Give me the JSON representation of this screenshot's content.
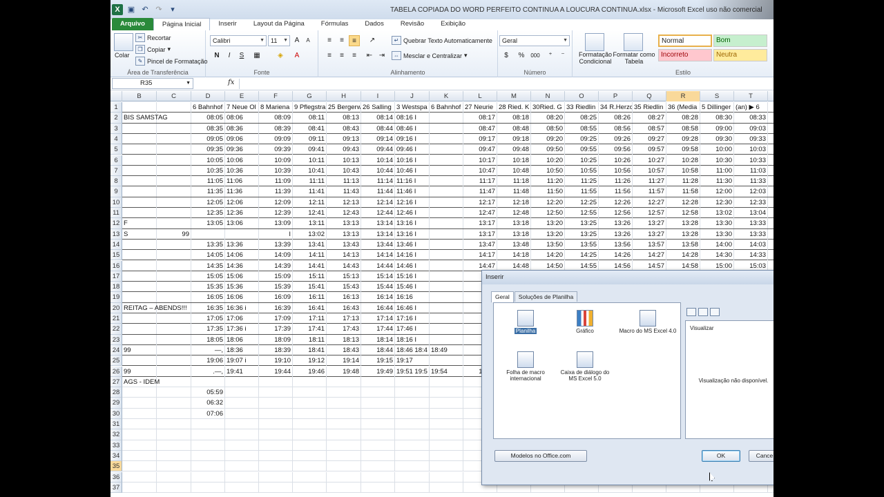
{
  "window": {
    "title": "TABELA COPIADA DO WORD PERFEITO CONTINUA A LOUCURA CONTINUA.xlsx - Microsoft Excel uso não comercial"
  },
  "tabs": [
    "Arquivo",
    "Página Inicial",
    "Inserir",
    "Layout da Página",
    "Fórmulas",
    "Dados",
    "Revisão",
    "Exibição"
  ],
  "ribbon": {
    "clipboard": {
      "paste": "Colar",
      "cut": "Recortar",
      "copy": "Copiar",
      "format_painter": "Pincel de Formatação",
      "label": "Área de Transferência"
    },
    "font": {
      "name": "Calibri",
      "size": "11",
      "bold": "N",
      "italic": "I",
      "underline": "S",
      "label": "Fonte"
    },
    "alignment": {
      "wrap": "Quebrar Texto Automaticamente",
      "merge": "Mesclar e Centralizar",
      "label": "Alinhamento"
    },
    "number": {
      "format": "Geral",
      "percent": "%",
      "thousands": "000",
      "label": "Número"
    },
    "styles": {
      "cond_format": "Formatação Condicional",
      "as_table": "Formatar como Tabela",
      "normal": "Normal",
      "bom": "Bom",
      "incorreto": "Incorreto",
      "neutra": "Neutra",
      "label": "Estilo"
    }
  },
  "formula_bar": {
    "name_box": "R35",
    "fx": "fx",
    "value": ""
  },
  "columns": [
    "B",
    "C",
    "D",
    "E",
    "F",
    "G",
    "H",
    "I",
    "J",
    "K",
    "L",
    "M",
    "N",
    "O",
    "P",
    "Q",
    "R",
    "S",
    "T"
  ],
  "selected_column": "R",
  "selected_row": "35",
  "rows": [
    {
      "n": "1",
      "c": {
        "D": "6 Bahnhof",
        "E": "7 Neue Ol",
        "F": "8 Mariena",
        "G": "9 Pflegstra",
        "H": "25 Bergerw",
        "I": "26 Salling",
        "J": "3 Westspa",
        "K": "6 Bahnhof",
        "L": "27 Neurie",
        "M": "28 Ried. K",
        "N": "30Ried. G",
        "O": "33 Riedlin",
        "P": "34 R.Herzo",
        "Q": "35 Riedlin",
        "R": "36 (Media",
        "S": "5 Dillinger",
        "T": "(an) ▶  6"
      }
    },
    {
      "n": "2",
      "c": {
        "B": "BIS SAMSTAG",
        "D": "08:05",
        "E": "08:06",
        "F": "08:09",
        "G": "08:11",
        "H": "08:13",
        "I": "08:14",
        "J": "08:16 I",
        "L": "08:17",
        "M": "08:18",
        "N": "08:20",
        "O": "08:25",
        "P": "08:26",
        "Q": "08:27",
        "R": "08:28",
        "S": "08:30",
        "T": "08:33"
      }
    },
    {
      "n": "3",
      "c": {
        "D": "08:35",
        "E": "08:36",
        "F": "08:39",
        "G": "08:41",
        "H": "08:43",
        "I": "08:44",
        "J": "08:46 I",
        "L": "08:47",
        "M": "08:48",
        "N": "08:50",
        "O": "08:55",
        "P": "08:56",
        "Q": "08:57",
        "R": "08:58",
        "S": "09:00",
        "T": "09:03"
      }
    },
    {
      "n": "4",
      "c": {
        "D": "09:05",
        "E": "09:06",
        "F": "09:09",
        "G": "09:11",
        "H": "09:13",
        "I": "09:14",
        "J": "09:16 I",
        "L": "09:17",
        "M": "09:18",
        "N": "09:20",
        "O": "09:25",
        "P": "09:26",
        "Q": "09:27",
        "R": "09:28",
        "S": "09:30",
        "T": "09:33"
      }
    },
    {
      "n": "5",
      "c": {
        "D": "09:35",
        "E": "09:36",
        "F": "09:39",
        "G": "09:41",
        "H": "09:43",
        "I": "09:44",
        "J": "09:46 I",
        "L": "09:47",
        "M": "09:48",
        "N": "09:50",
        "O": "09:55",
        "P": "09:56",
        "Q": "09:57",
        "R": "09:58",
        "S": "10:00",
        "T": "10:03"
      }
    },
    {
      "n": "6",
      "c": {
        "D": "10:05",
        "E": "10:06",
        "F": "10:09",
        "G": "10:11",
        "H": "10:13",
        "I": "10:14",
        "J": "10:16 I",
        "L": "10:17",
        "M": "10:18",
        "N": "10:20",
        "O": "10:25",
        "P": "10:26",
        "Q": "10:27",
        "R": "10:28",
        "S": "10:30",
        "T": "10:33"
      }
    },
    {
      "n": "7",
      "c": {
        "D": "10:35",
        "E": "10:36",
        "F": "10:39",
        "G": "10:41",
        "H": "10:43",
        "I": "10:44",
        "J": "10:46 I",
        "L": "10:47",
        "M": "10:48",
        "N": "10:50",
        "O": "10:55",
        "P": "10:56",
        "Q": "10:57",
        "R": "10:58",
        "S": "11:00",
        "T": "11:03"
      }
    },
    {
      "n": "8",
      "c": {
        "D": "11:05",
        "E": "11:06",
        "F": "11:09",
        "G": "11:11",
        "H": "11:13",
        "I": "11:14",
        "J": "11:16 I",
        "L": "11:17",
        "M": "11:18",
        "N": "11:20",
        "O": "11:25",
        "P": "11:26",
        "Q": "11:27",
        "R": "11:28",
        "S": "11:30",
        "T": "11:33"
      }
    },
    {
      "n": "9",
      "c": {
        "D": "11:35",
        "E": "11:36",
        "F": "11:39",
        "G": "11:41",
        "H": "11:43",
        "I": "11:44",
        "J": "11:46 I",
        "L": "11:47",
        "M": "11:48",
        "N": "11:50",
        "O": "11:55",
        "P": "11:56",
        "Q": "11:57",
        "R": "11:58",
        "S": "12:00",
        "T": "12:03"
      }
    },
    {
      "n": "10",
      "c": {
        "D": "12:05",
        "E": "12:06",
        "F": "12:09",
        "G": "12:11",
        "H": "12:13",
        "I": "12:14",
        "J": "12:16 I",
        "L": "12:17",
        "M": "12:18",
        "N": "12:20",
        "O": "12:25",
        "P": "12:26",
        "Q": "12:27",
        "R": "12:28",
        "S": "12:30",
        "T": "12:33"
      }
    },
    {
      "n": "11",
      "c": {
        "D": "12:35",
        "E": "12:36",
        "F": "12:39",
        "G": "12:41",
        "H": "12:43",
        "I": "12:44",
        "J": "12:46 I",
        "L": "12:47",
        "M": "12:48",
        "N": "12:50",
        "O": "12:55",
        "P": "12:56",
        "Q": "12:57",
        "R": "12:58",
        "S": "13:02",
        "T": "13:04"
      }
    },
    {
      "n": "12",
      "c": {
        "B": "F",
        "D": "13:05",
        "E": "13:06",
        "F": "13:09",
        "G": "13:11",
        "H": "13:13",
        "I": "13:14",
        "J": "13:16 I",
        "L": "13:17",
        "M": "13:18",
        "N": "13:20",
        "O": "13:25",
        "P": "13:26",
        "Q": "13:27",
        "R": "13:28",
        "S": "13:30",
        "T": "13:33"
      }
    },
    {
      "n": "13",
      "c": {
        "B": "S",
        "C": "99",
        "F": "I",
        "G": "13:02",
        "H": "13:13",
        "I": "13:14",
        "J": "13:16 I",
        "L": "13:17",
        "M": "13:18",
        "N": "13:20",
        "O": "13:25",
        "P": "13:26",
        "Q": "13:27",
        "R": "13:28",
        "S": "13:30",
        "T": "13:33"
      }
    },
    {
      "n": "14",
      "c": {
        "D": "13:35",
        "E": "13:36",
        "F": "13:39",
        "G": "13:41",
        "H": "13:43",
        "I": "13:44",
        "J": "13:46 I",
        "L": "13:47",
        "M": "13:48",
        "N": "13:50",
        "O": "13:55",
        "P": "13:56",
        "Q": "13:57",
        "R": "13:58",
        "S": "14:00",
        "T": "14:03"
      }
    },
    {
      "n": "15",
      "c": {
        "D": "14:05",
        "E": "14:06",
        "F": "14:09",
        "G": "14:11",
        "H": "14:13",
        "I": "14:14",
        "J": "14:16 I",
        "L": "14:17",
        "M": "14:18",
        "N": "14:20",
        "O": "14:25",
        "P": "14:26",
        "Q": "14:27",
        "R": "14:28",
        "S": "14:30",
        "T": "14:33"
      }
    },
    {
      "n": "16",
      "c": {
        "D": "14:35",
        "E": "14:36",
        "F": "14:39",
        "G": "14:41",
        "H": "14:43",
        "I": "14:44",
        "J": "14:46 I",
        "L": "14:47",
        "M": "14:48",
        "N": "14:50",
        "O": "14:55",
        "P": "14:56",
        "Q": "14:57",
        "R": "14:58",
        "S": "15:00",
        "T": "15:03"
      }
    },
    {
      "n": "17",
      "c": {
        "D": "15:05",
        "E": "15:06",
        "F": "15:09",
        "G": "15:11",
        "H": "15:13",
        "I": "15:14",
        "J": "15:16 I"
      }
    },
    {
      "n": "18",
      "c": {
        "D": "15:35",
        "E": "15:36",
        "F": "15:39",
        "G": "15:41",
        "H": "15:43",
        "I": "15:44",
        "J": "15:46 I"
      }
    },
    {
      "n": "19",
      "c": {
        "D": "16:05",
        "E": "16:06",
        "F": "16:09",
        "G": "16:11",
        "H": "16:13",
        "I": "16:14",
        "J": "16:16"
      }
    },
    {
      "n": "20",
      "c": {
        "B": "REITAG – ABENDS!!!",
        "D": "16:35",
        "E": "16:36 i",
        "F": "16:39",
        "G": "16:41",
        "H": "16:43",
        "I": "16:44",
        "J": "16:46 I"
      }
    },
    {
      "n": "21",
      "c": {
        "D": "17:05",
        "E": "17:06",
        "F": "17:09",
        "G": "17:11",
        "H": "17:13",
        "I": "17:14",
        "J": "17:16 I"
      }
    },
    {
      "n": "22",
      "c": {
        "D": "17:35",
        "E": "17:36 i",
        "F": "17:39",
        "G": "17:41",
        "H": "17:43",
        "I": "17:44",
        "J": "17:46 I"
      }
    },
    {
      "n": "23",
      "c": {
        "D": "18:05",
        "E": "18:06",
        "F": "18:09",
        "G": "18:11",
        "H": "18:13",
        "I": "18:14",
        "J": "18:16 I"
      }
    },
    {
      "n": "24",
      "c": {
        "B": "99",
        "D": "—,",
        "E": "18:36",
        "F": "18:39",
        "G": "18:41",
        "H": "18:43",
        "I": "18:44",
        "J": "18:46 18:4",
        "K": "18:49"
      }
    },
    {
      "n": "25",
      "c": {
        "D": "19:06",
        "E": "19:07 i",
        "F": "19:10",
        "G": "19:12",
        "H": "19:14",
        "I": "19:15",
        "J": "19:17"
      }
    },
    {
      "n": "26",
      "c": {
        "B": "99",
        "D": ".—,",
        "E": "19:41",
        "F": "19:44",
        "G": "19:46",
        "H": "19:48",
        "I": "19:49",
        "J": "19:51 19:5",
        "K": "19:54",
        "L": "19:56"
      }
    },
    {
      "n": "27",
      "c": {
        "B": "AGS - IDEM"
      }
    },
    {
      "n": "28",
      "c": {
        "D": "05:59"
      }
    },
    {
      "n": "29",
      "c": {
        "D": "06:32"
      }
    },
    {
      "n": "30",
      "c": {
        "D": "07:06"
      }
    },
    {
      "n": "31",
      "c": {}
    },
    {
      "n": "32",
      "c": {}
    },
    {
      "n": "33",
      "c": {}
    },
    {
      "n": "34",
      "c": {}
    },
    {
      "n": "35",
      "c": {}
    },
    {
      "n": "36",
      "c": {}
    },
    {
      "n": "37",
      "c": {}
    }
  ],
  "dialog": {
    "title": "Inserir",
    "tabs": [
      "Geral",
      "Soluções de Planilha"
    ],
    "items": [
      {
        "label": "Planilha",
        "icon": "worksheet-icon",
        "selected": true
      },
      {
        "label": "Gráfico",
        "icon": "chart-icon",
        "selected": false
      },
      {
        "label": "Macro do MS Excel 4.0",
        "icon": "macro-icon",
        "selected": false
      },
      {
        "label": "Folha de macro internacional",
        "icon": "intl-macro-icon",
        "selected": false
      },
      {
        "label": "Caixa de diálogo do MS Excel 5.0",
        "icon": "dialog-sheet-icon",
        "selected": false
      }
    ],
    "preview_label": "Visualizar",
    "preview_text": "Visualização não disponível.",
    "office_btn": "Modelos no Office.com",
    "ok": "OK",
    "cancel": "Cance"
  },
  "colors": {
    "file_tab": "#2a8a3a",
    "selected_header": "#f9d99a",
    "normal_style": "#ffffff",
    "bom_style": "#c6efce",
    "incorreto_style": "#ffc7ce",
    "neutra_style": "#ffeb9c"
  }
}
